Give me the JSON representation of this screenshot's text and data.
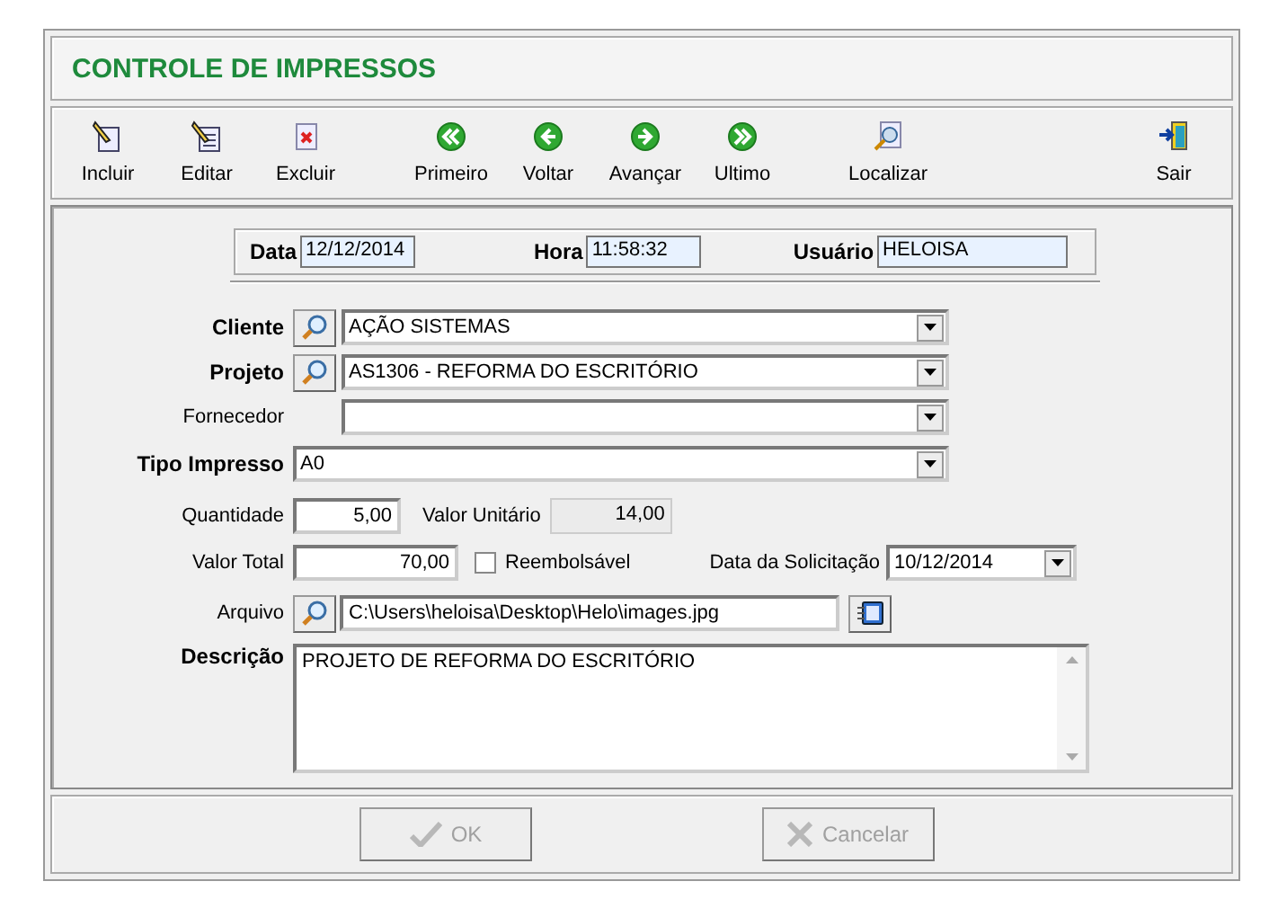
{
  "window": {
    "title": "CONTROLE DE IMPRESSOS"
  },
  "toolbar": [
    {
      "label": "Incluir",
      "kind": "new"
    },
    {
      "label": "Editar",
      "kind": "edit"
    },
    {
      "label": "Excluir",
      "kind": "delete"
    },
    {
      "label": "Primeiro",
      "kind": "first"
    },
    {
      "label": "Voltar",
      "kind": "prev"
    },
    {
      "label": "Avançar",
      "kind": "next"
    },
    {
      "label": "Ultimo",
      "kind": "last"
    },
    {
      "label": "Localizar",
      "kind": "find"
    },
    {
      "label": "Sair",
      "kind": "exit"
    }
  ],
  "header": [
    {
      "label": "Data",
      "value": "12/12/2014"
    },
    {
      "label": "Hora",
      "value": "11:58:32"
    },
    {
      "label": "Usuário",
      "value": "HELOISA"
    }
  ],
  "cliente": {
    "label": "Cliente",
    "value": "AÇÃO SISTEMAS"
  },
  "projeto": {
    "label": "Projeto",
    "value": "AS1306 - REFORMA DO ESCRITÓRIO"
  },
  "fornecedor": {
    "label": "Fornecedor"
  },
  "tipo_impresso": {
    "label": "Tipo Impresso",
    "value": "A0"
  },
  "quantidade": {
    "label": "Quantidade",
    "value": "5,00"
  },
  "valor_unitario": {
    "label": "Valor Unitário",
    "value": "14,00"
  },
  "valor_total": {
    "label": "Valor Total",
    "value": "70,00"
  },
  "reembolsavel": {
    "label": "Reembolsável",
    "checked": false
  },
  "data_solicitacao": {
    "label": "Data da Solicitação",
    "value": "10/12/2014"
  },
  "arquivo": {
    "label": "Arquivo",
    "value": "C:\\Users\\heloisa\\Desktop\\Helo\\images.jpg"
  },
  "descricao": {
    "label": "Descrição",
    "value": "PROJETO DE REFORMA DO ESCRITÓRIO"
  },
  "buttons": [
    {
      "label": "OK",
      "kind": "ok",
      "disabled": true
    },
    {
      "label": "Cancelar",
      "kind": "cancel",
      "disabled": true
    }
  ]
}
